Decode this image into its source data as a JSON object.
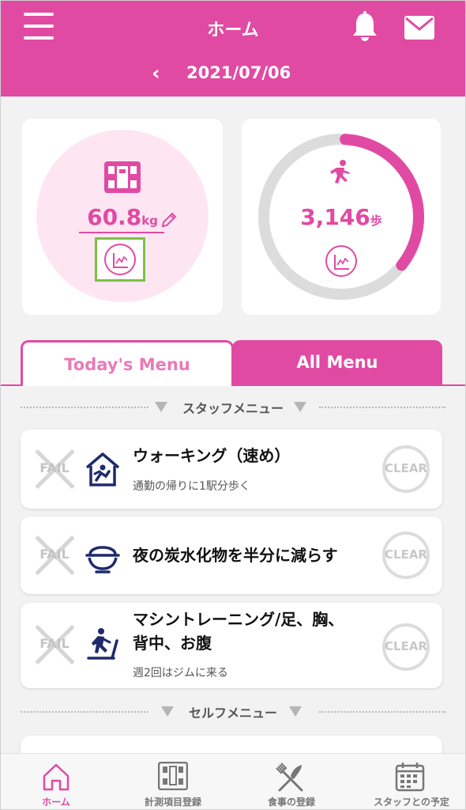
{
  "header": {
    "title": "ホーム",
    "date": "2021/07/06",
    "back_glyph": "‹",
    "accent_color": "#e14aa3"
  },
  "weight_card": {
    "value": "60.8",
    "unit": "kg",
    "icon": "scale-icon",
    "edit_icon": "pencil-icon",
    "graph_icon": "chart-icon"
  },
  "steps_card": {
    "value": "3,146",
    "unit": "歩",
    "icon": "runner-icon",
    "graph_icon": "chart-icon"
  },
  "tabs": [
    {
      "label": "Today's Menu",
      "active": false
    },
    {
      "label": "All Menu",
      "active": true
    }
  ],
  "sections": {
    "staff": "スタッフメニュー",
    "self": "セルフメニュー"
  },
  "status_labels": {
    "fail": "FAIL",
    "clear": "CLEAR"
  },
  "menu_items": [
    {
      "title": "ウォーキング（速め）",
      "subtitle": "通勤の帰りに1駅分歩く",
      "icon": "house-exercise-icon"
    },
    {
      "title": "夜の炭水化物を半分に減らす",
      "subtitle": "",
      "icon": "rice-bowl-icon"
    },
    {
      "title_line1": "マシントレーニング/足、胸、",
      "title_line2": "背中、お腹",
      "subtitle": "週2回はジムに来る",
      "icon": "treadmill-icon"
    }
  ],
  "bottom_nav": [
    {
      "label": "ホーム",
      "icon": "home-icon",
      "active": true
    },
    {
      "label": "計測項目登録",
      "icon": "scale-icon",
      "active": false
    },
    {
      "label": "食事の登録",
      "icon": "fork-knife-icon",
      "active": false
    },
    {
      "label": "スタッフとの予定",
      "icon": "calendar-icon",
      "active": false
    }
  ]
}
